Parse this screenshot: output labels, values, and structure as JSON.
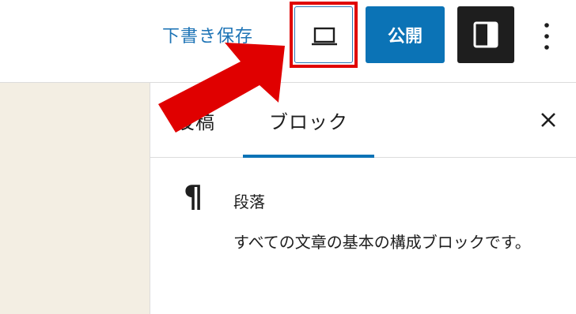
{
  "header": {
    "save_draft_label": "下書き保存",
    "publish_label": "公開"
  },
  "icons": {
    "preview": "laptop-icon",
    "settings": "sidebar-toggle-icon",
    "more": "vertical-ellipsis-icon",
    "close": "close-icon",
    "block": "paragraph-icon"
  },
  "sidebar": {
    "tabs": [
      {
        "label": "投稿"
      },
      {
        "label": "ブロック"
      }
    ],
    "active_tab": "ブロック",
    "block": {
      "name": "段落",
      "description": "すべての文章の基本の構成ブロックです。"
    }
  },
  "colors": {
    "accent": "#0b73b6",
    "link": "#1e74b6",
    "annotation": "#e00000",
    "editor_bg": "#f3eee3"
  }
}
